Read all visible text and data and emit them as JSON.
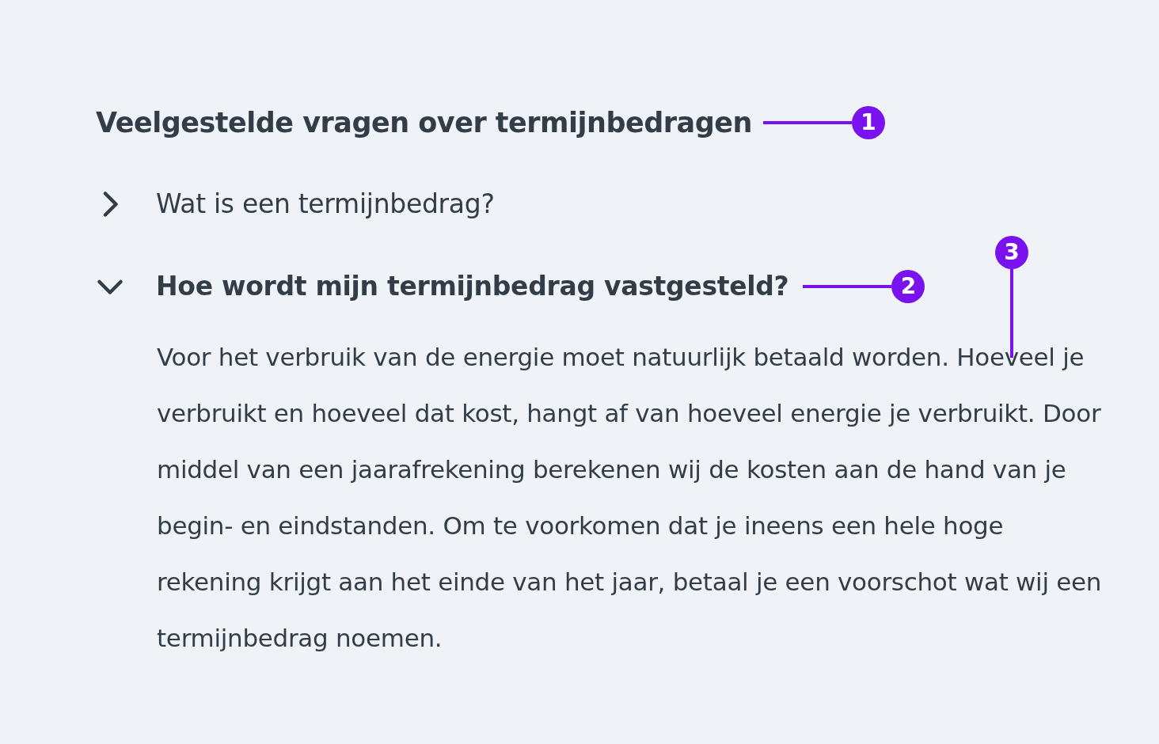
{
  "heading": {
    "text": "Veelgestelde vragen over termijnbedragen",
    "annotation": "1"
  },
  "faq": [
    {
      "question": "Wat is een termijnbedrag?",
      "expanded": false
    },
    {
      "question": "Hoe wordt mijn termijnbedrag vastgesteld?",
      "expanded": true,
      "annotation": "2",
      "answer": "Voor het verbruik van de energie moet natuurlijk betaald worden. Hoeveel je verbruikt en hoeveel dat kost, hangt af van hoeveel energie je verbruikt. Door middel van een jaarafrekening berekenen wij de kosten aan de hand van je begin- en eindstanden. Om te voorkomen dat je ineens een hele hoge rekening krijgt aan het einde van het jaar, betaal je een voorschot wat wij een termijnbedrag noemen.",
      "answer_annotation": "3"
    }
  ]
}
